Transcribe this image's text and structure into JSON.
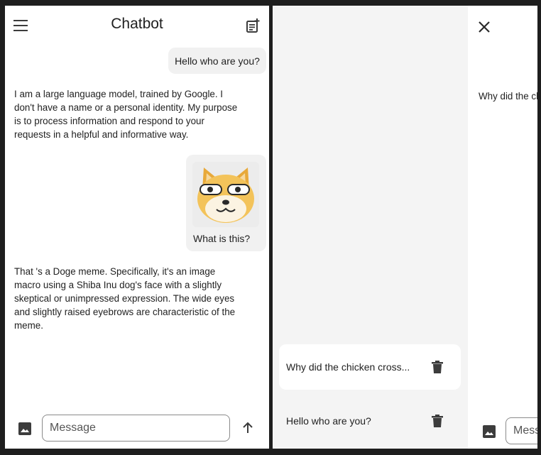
{
  "chat": {
    "title": "Chatbot",
    "messages": [
      {
        "role": "user",
        "text": "Hello who are you?"
      },
      {
        "role": "bot",
        "text": "I  am a large language model, trained by Google.  I don't have  a name or a personal identity.  My purpose is to process information and respond  to your requests in a helpful and informative way."
      },
      {
        "role": "user",
        "image_icon": "doge-meme-image",
        "text": "What is this?"
      },
      {
        "role": "bot",
        "text": "That 's a Doge meme.  Specifically, it's an image macro using  a Shiba Inu dog's face with a slightly skeptical or unimpressed expression.   The wide eyes and slightly raised eyebrows are characteristic of the meme."
      }
    ],
    "composer": {
      "placeholder": "Message"
    },
    "icons": {
      "menu": "menu-icon",
      "new_chat": "new-chat-icon",
      "image": "image-icon",
      "send": "send-arrow-icon"
    }
  },
  "drawer": {
    "history": [
      {
        "label": "Why did the chicken cross...",
        "active": true
      },
      {
        "label": "Hello who are you?",
        "active": false
      }
    ],
    "peek_text": "Why  did the chicken cross the road? To get to the other side",
    "peek_input_placeholder": "Message",
    "icons": {
      "close": "close-icon",
      "delete": "trash-icon"
    }
  },
  "colors": {
    "background": "#1e1e1e",
    "surface": "#ffffff",
    "drawer": "#f4f4f4",
    "bubble": "#f1f1f1",
    "icon": "#3c3c3c"
  }
}
